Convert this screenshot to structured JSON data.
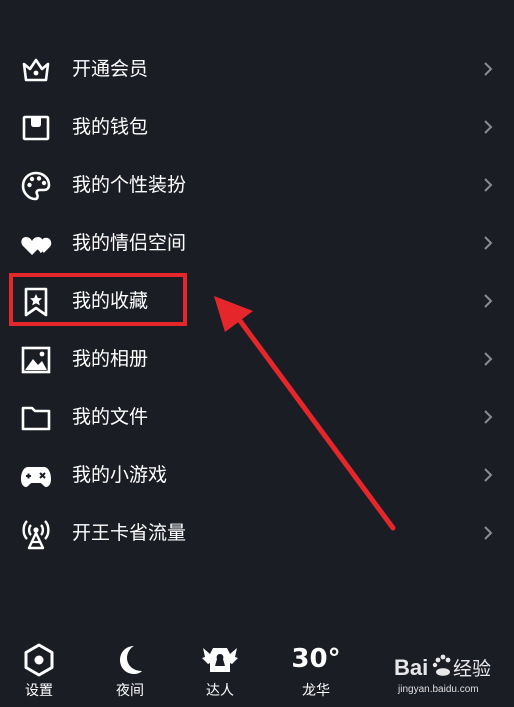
{
  "menu": {
    "items": [
      {
        "label": "开通会员",
        "icon": "crown-icon"
      },
      {
        "label": "我的钱包",
        "icon": "wallet-icon"
      },
      {
        "label": "我的个性装扮",
        "icon": "palette-icon"
      },
      {
        "label": "我的情侣空间",
        "icon": "hearts-icon"
      },
      {
        "label": "我的收藏",
        "icon": "bookmark-star-icon"
      },
      {
        "label": "我的相册",
        "icon": "photo-icon"
      },
      {
        "label": "我的文件",
        "icon": "folder-icon"
      },
      {
        "label": "我的小游戏",
        "icon": "gamepad-icon"
      },
      {
        "label": "开王卡省流量",
        "icon": "signal-tower-icon"
      }
    ]
  },
  "annotation": {
    "highlighted_item": "我的收藏",
    "color": "#e5262b"
  },
  "bottom_bar": {
    "settings_label": "设置",
    "night_label": "夜间",
    "expert_label": "达人",
    "weather_temp": "30°",
    "weather_city": "龙华"
  },
  "watermark": {
    "brand": "Bai 经验",
    "url": "jingyan.baidu.com"
  },
  "colors": {
    "background": "#1b1d24",
    "text": "#ffffff",
    "chevron": "#8a8c93"
  }
}
